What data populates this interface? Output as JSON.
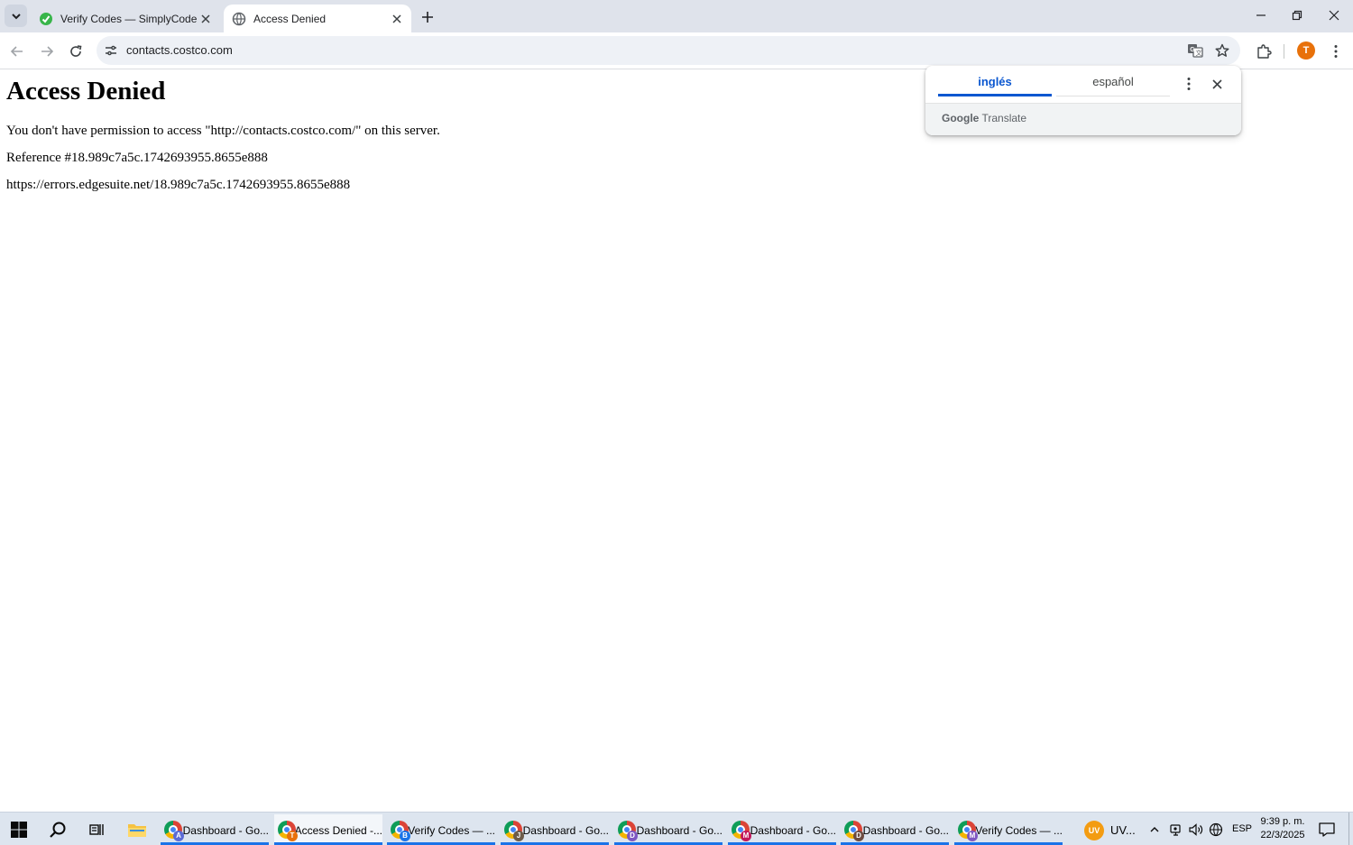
{
  "tabs": [
    {
      "title": "Verify Codes — SimplyCodes",
      "favicon": "simplycodes-logo-icon",
      "active": false
    },
    {
      "title": "Access Denied",
      "favicon": "globe-icon",
      "active": true
    }
  ],
  "toolbar": {
    "url": "contacts.costco.com",
    "profile_initial": "T"
  },
  "page": {
    "heading": "Access Denied",
    "message": "You don't have permission to access \"http://contacts.costco.com/\" on this server.",
    "reference": "Reference #18.989c7a5c.1742693955.8655e888",
    "error_url": "https://errors.edgesuite.net/18.989c7a5c.1742693955.8655e888"
  },
  "translate_popup": {
    "source_lang": "inglés",
    "target_lang": "español",
    "footer_brand": "Google",
    "footer_product": "Translate"
  },
  "taskbar": {
    "apps": [
      {
        "label": "Dashboard - Go...",
        "badge": "A",
        "badge_color": "#5b6bd6",
        "active": false
      },
      {
        "label": "Access Denied -...",
        "badge": "T",
        "badge_color": "#e8710a",
        "active": true
      },
      {
        "label": "Verify Codes — ...",
        "badge": "B",
        "badge_color": "#1a73e8",
        "active": false
      },
      {
        "label": "Dashboard - Go...",
        "badge": "J",
        "badge_color": "#6d5c4a",
        "active": false
      },
      {
        "label": "Dashboard - Go...",
        "badge": "D",
        "badge_color": "#7e57c2",
        "active": false
      },
      {
        "label": "Dashboard - Go...",
        "badge": "M",
        "badge_color": "#c2185b",
        "active": false
      },
      {
        "label": "Dashboard - Go...",
        "badge": "D",
        "badge_color": "#6d4c41",
        "active": false
      },
      {
        "label": "Verify Codes — ...",
        "badge": "M",
        "badge_color": "#7e57c2",
        "active": false
      }
    ],
    "uv_app": {
      "icon_text": "UV",
      "label": "UV..."
    },
    "language": "ESP",
    "time": "9:39 p. m.",
    "date": "22/3/2025"
  },
  "colors": {
    "accent": "#0b57d0",
    "tabstrip": "#dfe3eb",
    "avatar": "#e8710a"
  }
}
